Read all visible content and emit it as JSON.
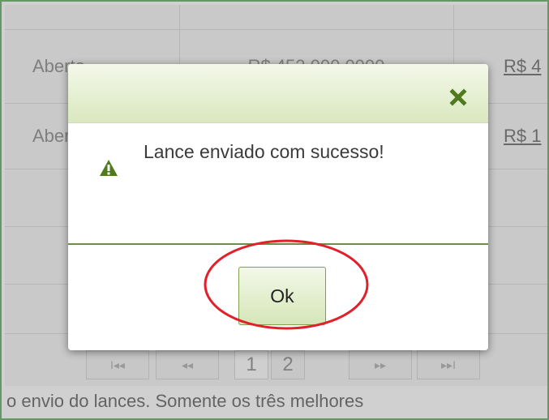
{
  "background": {
    "rows": [
      {
        "status": "Aberto",
        "amount": "R$ 452.000,0000",
        "link": "R$ 4"
      },
      {
        "status": "Aberto",
        "amount": "",
        "link": "R$ 1"
      }
    ],
    "pager": {
      "first": "I◂◂",
      "prev": "◂◂",
      "pages": [
        "1",
        "2"
      ],
      "next": "▸▸",
      "last": "▸▸I"
    },
    "bottom_text": "o envio do lances. Somente os três melhores"
  },
  "dialog": {
    "close_icon": "close-x-icon",
    "icon": "warning-icon",
    "message": "Lance enviado com sucesso!",
    "ok_label": "Ok"
  },
  "colors": {
    "frame": "#3d9a3d",
    "header_gradient_top": "#f4f8ea",
    "header_gradient_bottom": "#dae8bf",
    "close_icon": "#4f7a1e",
    "warning_icon": "#4f7a1e",
    "divider": "#6b8f45",
    "annotation_circle": "#e0202a"
  }
}
